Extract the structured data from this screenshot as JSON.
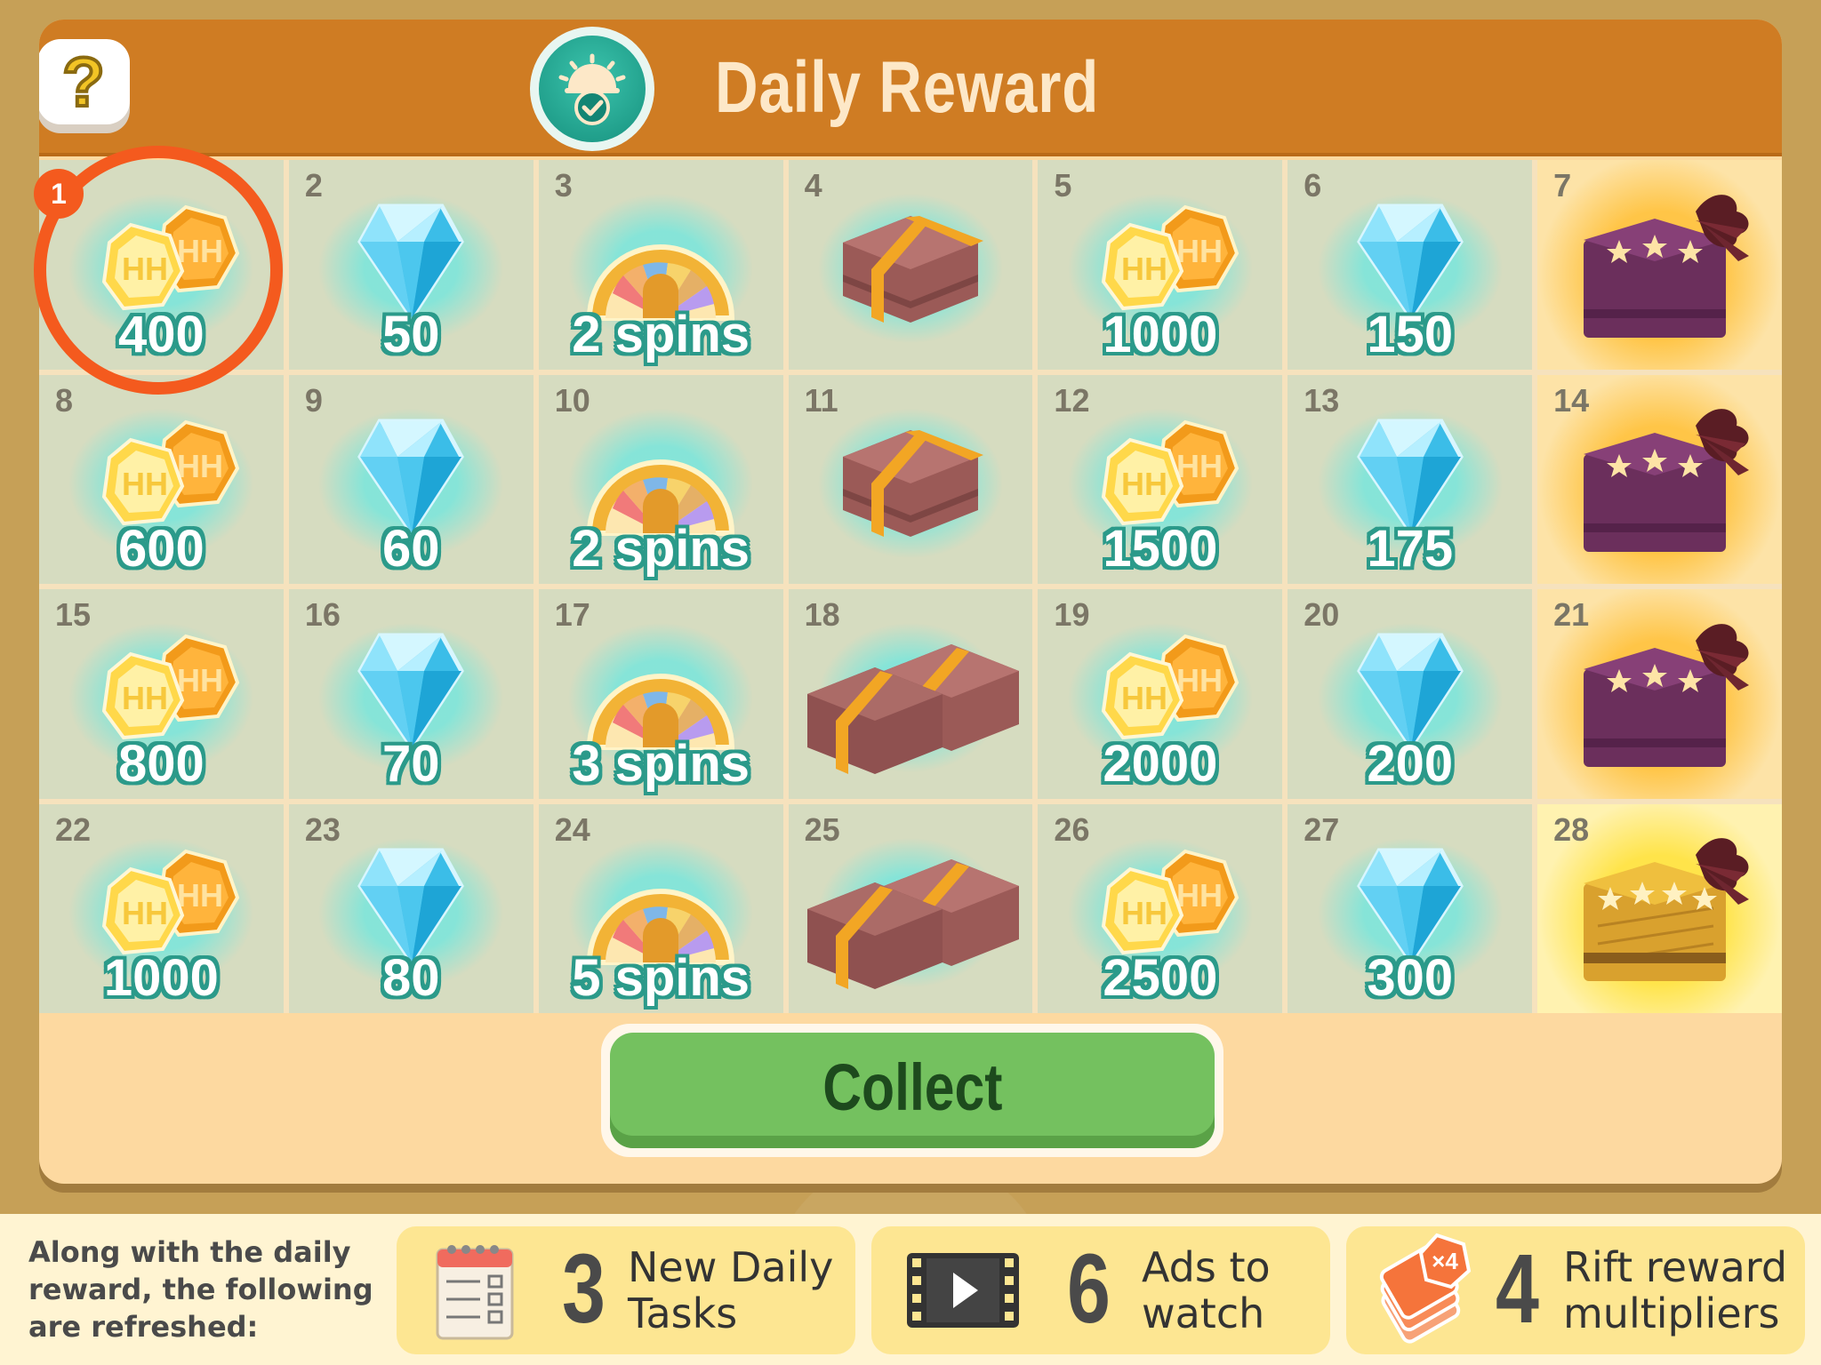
{
  "header": {
    "title": "Daily Reward",
    "help_label": "?"
  },
  "claimed_day": "1",
  "days": [
    {
      "day": "1",
      "type": "coins",
      "amount": "400"
    },
    {
      "day": "2",
      "type": "gems",
      "amount": "50"
    },
    {
      "day": "3",
      "type": "spins",
      "amount": "2 spins"
    },
    {
      "day": "4",
      "type": "box",
      "amount": ""
    },
    {
      "day": "5",
      "type": "coins",
      "amount": "1000"
    },
    {
      "day": "6",
      "type": "gems",
      "amount": "150"
    },
    {
      "day": "7",
      "type": "gift",
      "amount": ""
    },
    {
      "day": "8",
      "type": "coins",
      "amount": "600"
    },
    {
      "day": "9",
      "type": "gems",
      "amount": "60"
    },
    {
      "day": "10",
      "type": "spins",
      "amount": "2 spins"
    },
    {
      "day": "11",
      "type": "box",
      "amount": ""
    },
    {
      "day": "12",
      "type": "coins",
      "amount": "1500"
    },
    {
      "day": "13",
      "type": "gems",
      "amount": "175"
    },
    {
      "day": "14",
      "type": "gift",
      "amount": ""
    },
    {
      "day": "15",
      "type": "coins",
      "amount": "800"
    },
    {
      "day": "16",
      "type": "gems",
      "amount": "70"
    },
    {
      "day": "17",
      "type": "spins",
      "amount": "3 spins"
    },
    {
      "day": "18",
      "type": "box2",
      "amount": ""
    },
    {
      "day": "19",
      "type": "coins",
      "amount": "2000"
    },
    {
      "day": "20",
      "type": "gems",
      "amount": "200"
    },
    {
      "day": "21",
      "type": "gift",
      "amount": ""
    },
    {
      "day": "22",
      "type": "coins",
      "amount": "1000"
    },
    {
      "day": "23",
      "type": "gems",
      "amount": "80"
    },
    {
      "day": "24",
      "type": "spins",
      "amount": "5 spins"
    },
    {
      "day": "25",
      "type": "box2",
      "amount": ""
    },
    {
      "day": "26",
      "type": "coins",
      "amount": "2500"
    },
    {
      "day": "27",
      "type": "gems",
      "amount": "300"
    },
    {
      "day": "28",
      "type": "gift-gold",
      "amount": ""
    }
  ],
  "collect_label": "Collect",
  "footer": {
    "note": "Along with the daily reward, the following are refreshed:",
    "cards": [
      {
        "count": "3",
        "label": "New Daily Tasks",
        "icon": "calendar-checklist-icon"
      },
      {
        "count": "6",
        "label": "Ads to watch",
        "icon": "film-play-icon"
      },
      {
        "count": "4",
        "label": "Rift reward multipliers",
        "icon": "multiplier-cards-icon",
        "badge": "×4"
      }
    ]
  },
  "colors": {
    "header": "#cf7c23",
    "panel": "#fdd9a0",
    "cell": "#d6dcc0",
    "accent_ring": "#f45a1e",
    "collect_green": "#74c15f",
    "amount_outline": "#2b9a8a"
  }
}
